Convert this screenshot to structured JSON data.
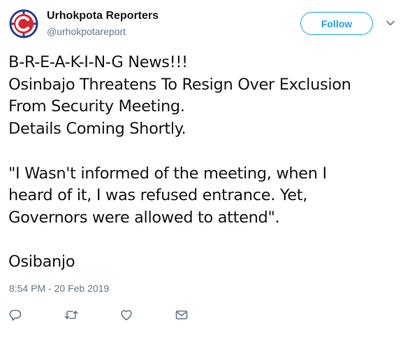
{
  "author": {
    "name": "Urhokpota Reporters",
    "handle": "@urhokpotareport",
    "avatar_icon": "urhokpota-logo-icon"
  },
  "follow_button": {
    "label": "Follow"
  },
  "menu_icon": "chevron-down-icon",
  "tweet": {
    "lines": [
      "B-R-E-A-K-I-N-G News!!!",
      "Osinbajo Threatens To Resign Over Exclusion",
      "From Security Meeting.",
      "Details Coming Shortly.",
      "",
      "\"I Wasn't informed of the meeting, when I",
      "heard of it, I was refused entrance. Yet,",
      "Governors were allowed to attend\".",
      "",
      "Osibanjo"
    ],
    "timestamp": "8:54 PM - 20 Feb 2019"
  },
  "actions": [
    {
      "name": "reply-icon"
    },
    {
      "name": "retweet-icon"
    },
    {
      "name": "like-icon"
    },
    {
      "name": "direct-message-icon"
    }
  ],
  "colors": {
    "accent": "#1da1f2",
    "text": "#14171a",
    "secondary_text": "#657786",
    "logo_red": "#d9262e",
    "logo_blue": "#2a3f8f"
  }
}
